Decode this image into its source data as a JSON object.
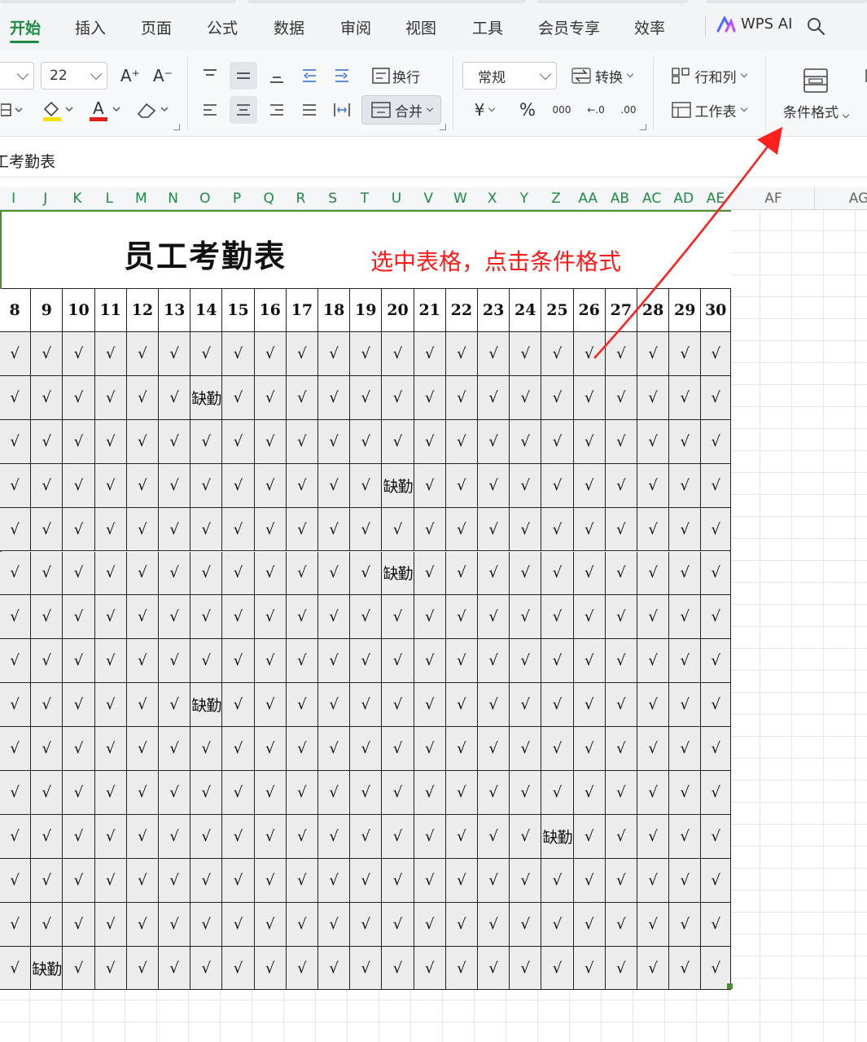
{
  "tabs": [
    {
      "label": "开始",
      "active": true
    },
    {
      "label": "插入"
    },
    {
      "label": "页面"
    },
    {
      "label": "公式"
    },
    {
      "label": "数据"
    },
    {
      "label": "审阅"
    },
    {
      "label": "视图"
    },
    {
      "label": "工具"
    },
    {
      "label": "会员专享"
    },
    {
      "label": "效率"
    }
  ],
  "wps_ai_label": "WPS AI",
  "ribbon": {
    "font_size_value": "22",
    "font_grow_label": "A⁺",
    "font_shrink_label": "A⁻",
    "wrap_label": "换行",
    "merge_label": "合并",
    "number_format_value": "常规",
    "convert_label": "转换",
    "rows_cols_label": "行和列",
    "worksheet_label": "工作表",
    "conditional_format_label": "条件格式",
    "currency_symbol": "¥",
    "percent_symbol": "%",
    "thousands_symbol": "000",
    "dec_inc_symbol": "←.0",
    "dec_dec_symbol": ".00"
  },
  "formula_bar": {
    "content": "工考勤表"
  },
  "column_headers_in_table": [
    "I",
    "J",
    "K",
    "L",
    "M",
    "N",
    "O",
    "P",
    "Q",
    "R",
    "S",
    "T",
    "U",
    "V",
    "W",
    "X",
    "Y",
    "Z",
    "AA",
    "AB",
    "AC",
    "AD",
    "AE"
  ],
  "column_headers_outside": [
    "AF",
    "AG"
  ],
  "sheet": {
    "title": "员工考勤表",
    "annotation": "选中表格，点击条件格式",
    "days": [
      "8",
      "9",
      "10",
      "11",
      "12",
      "13",
      "14",
      "15",
      "16",
      "17",
      "18",
      "19",
      "20",
      "21",
      "22",
      "23",
      "24",
      "25",
      "26",
      "27",
      "28",
      "29",
      "30"
    ],
    "present_mark": "√",
    "absent_mark": "缺勤",
    "rows": [
      [
        "√",
        "√",
        "√",
        "√",
        "√",
        "√",
        "√",
        "√",
        "√",
        "√",
        "√",
        "√",
        "√",
        "√",
        "√",
        "√",
        "√",
        "√",
        "√",
        "√",
        "√",
        "√",
        "√"
      ],
      [
        "√",
        "√",
        "√",
        "√",
        "√",
        "√",
        "缺勤",
        "√",
        "√",
        "√",
        "√",
        "√",
        "√",
        "√",
        "√",
        "√",
        "√",
        "√",
        "√",
        "√",
        "√",
        "√",
        "√"
      ],
      [
        "√",
        "√",
        "√",
        "√",
        "√",
        "√",
        "√",
        "√",
        "√",
        "√",
        "√",
        "√",
        "√",
        "√",
        "√",
        "√",
        "√",
        "√",
        "√",
        "√",
        "√",
        "√",
        "√"
      ],
      [
        "√",
        "√",
        "√",
        "√",
        "√",
        "√",
        "√",
        "√",
        "√",
        "√",
        "√",
        "√",
        "缺勤",
        "√",
        "√",
        "√",
        "√",
        "√",
        "√",
        "√",
        "√",
        "√",
        "√"
      ],
      [
        "√",
        "√",
        "√",
        "√",
        "√",
        "√",
        "√",
        "√",
        "√",
        "√",
        "√",
        "√",
        "√",
        "√",
        "√",
        "√",
        "√",
        "√",
        "√",
        "√",
        "√",
        "√",
        "√"
      ],
      [
        "√",
        "√",
        "√",
        "√",
        "√",
        "√",
        "√",
        "√",
        "√",
        "√",
        "√",
        "√",
        "缺勤",
        "√",
        "√",
        "√",
        "√",
        "√",
        "√",
        "√",
        "√",
        "√",
        "√"
      ],
      [
        "√",
        "√",
        "√",
        "√",
        "√",
        "√",
        "√",
        "√",
        "√",
        "√",
        "√",
        "√",
        "√",
        "√",
        "√",
        "√",
        "√",
        "√",
        "√",
        "√",
        "√",
        "√",
        "√"
      ],
      [
        "√",
        "√",
        "√",
        "√",
        "√",
        "√",
        "√",
        "√",
        "√",
        "√",
        "√",
        "√",
        "√",
        "√",
        "√",
        "√",
        "√",
        "√",
        "√",
        "√",
        "√",
        "√",
        "√"
      ],
      [
        "√",
        "√",
        "√",
        "√",
        "√",
        "√",
        "缺勤",
        "√",
        "√",
        "√",
        "√",
        "√",
        "√",
        "√",
        "√",
        "√",
        "√",
        "√",
        "√",
        "√",
        "√",
        "√",
        "√"
      ],
      [
        "√",
        "√",
        "√",
        "√",
        "√",
        "√",
        "√",
        "√",
        "√",
        "√",
        "√",
        "√",
        "√",
        "√",
        "√",
        "√",
        "√",
        "√",
        "√",
        "√",
        "√",
        "√",
        "√"
      ],
      [
        "√",
        "√",
        "√",
        "√",
        "√",
        "√",
        "√",
        "√",
        "√",
        "√",
        "√",
        "√",
        "√",
        "√",
        "√",
        "√",
        "√",
        "√",
        "√",
        "√",
        "√",
        "√",
        "√"
      ],
      [
        "√",
        "√",
        "√",
        "√",
        "√",
        "√",
        "√",
        "√",
        "√",
        "√",
        "√",
        "√",
        "√",
        "√",
        "√",
        "√",
        "√",
        "缺勤",
        "√",
        "√",
        "√",
        "√",
        "√"
      ],
      [
        "√",
        "√",
        "√",
        "√",
        "√",
        "√",
        "√",
        "√",
        "√",
        "√",
        "√",
        "√",
        "√",
        "√",
        "√",
        "√",
        "√",
        "√",
        "√",
        "√",
        "√",
        "√",
        "√"
      ],
      [
        "√",
        "√",
        "√",
        "√",
        "√",
        "√",
        "√",
        "√",
        "√",
        "√",
        "√",
        "√",
        "√",
        "√",
        "√",
        "√",
        "√",
        "√",
        "√",
        "√",
        "√",
        "√",
        "√"
      ],
      [
        "√",
        "缺勤",
        "√",
        "√",
        "√",
        "√",
        "√",
        "√",
        "√",
        "√",
        "√",
        "√",
        "√",
        "√",
        "√",
        "√",
        "√",
        "√",
        "√",
        "√",
        "√",
        "√",
        "√"
      ]
    ]
  },
  "colors": {
    "accent_green": "#1e8a44",
    "selection_border": "#4a8f2a",
    "annotation_red": "#ff1a1a",
    "font_color_red": "#e02020",
    "highlight_yellow": "#f5e000"
  }
}
